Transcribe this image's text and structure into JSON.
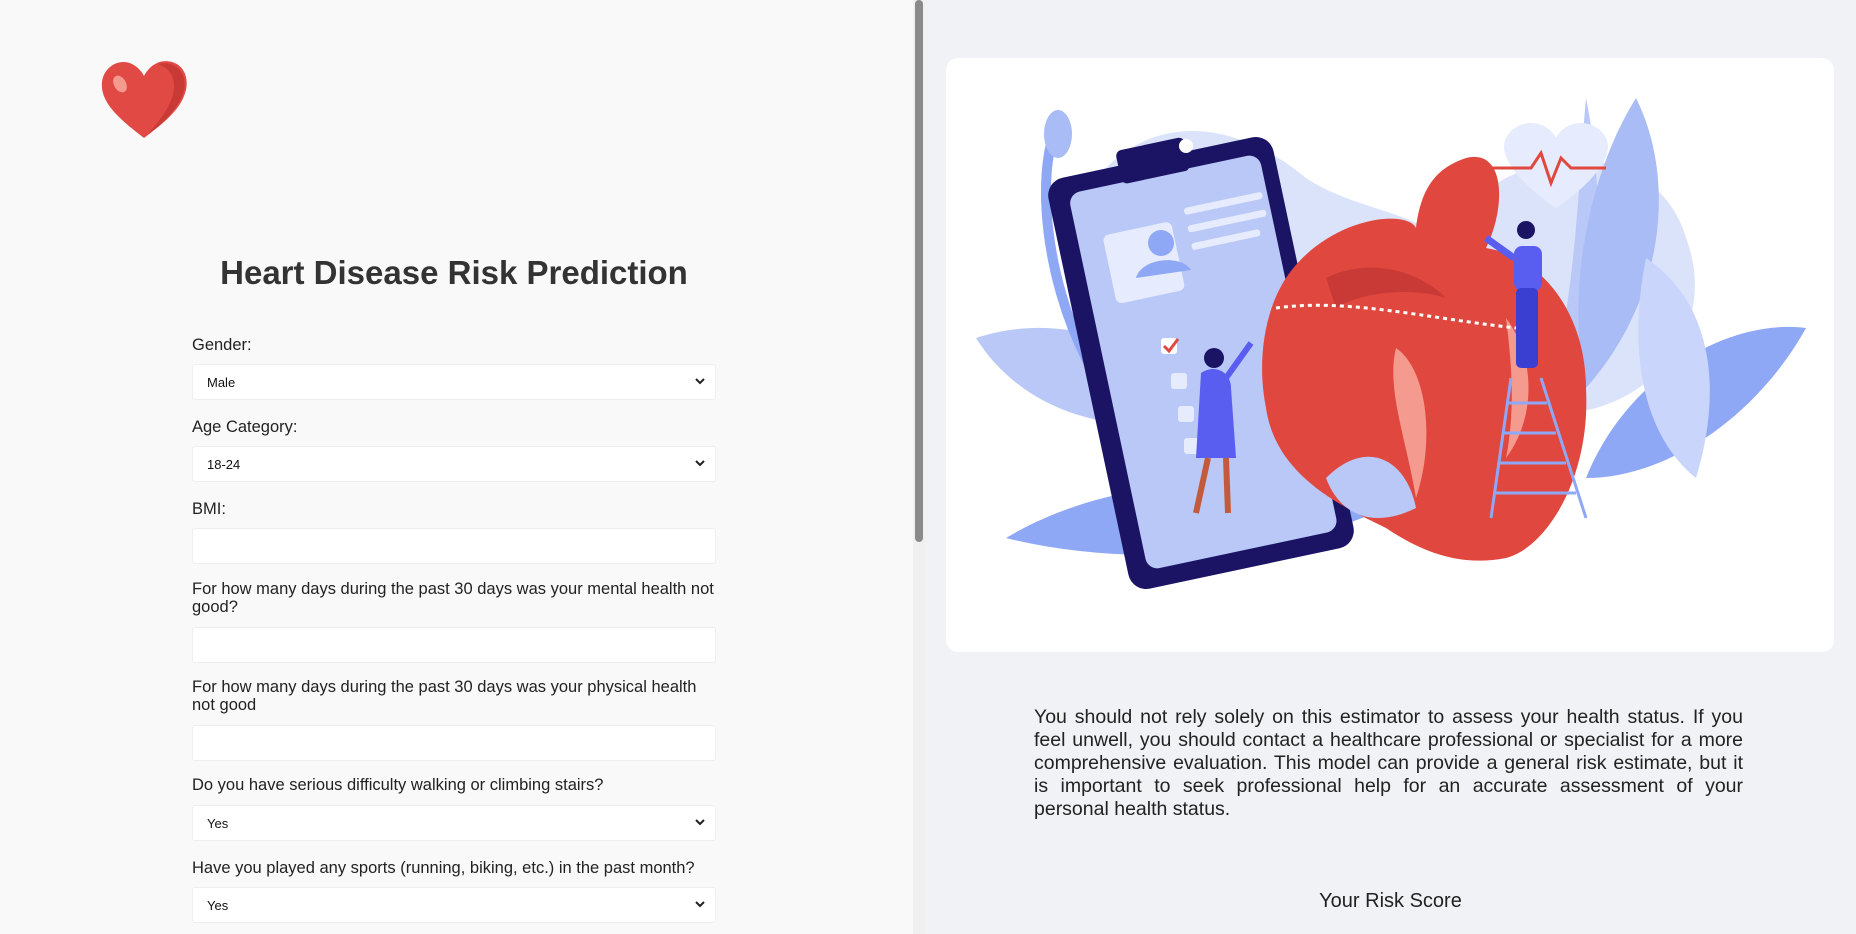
{
  "app": {
    "title": "Heart Disease Risk Prediction"
  },
  "form": {
    "gender": {
      "label": "Gender:",
      "value": "Male"
    },
    "age": {
      "label": "Age Category:",
      "value": "18-24"
    },
    "bmi": {
      "label": "BMI:",
      "value": ""
    },
    "mental": {
      "label": "For how many days during the past 30 days was your mental health not good?",
      "value": ""
    },
    "physical": {
      "label": "For how many days during the past 30 days was your physical health not good",
      "value": ""
    },
    "walking": {
      "label": "Do you have serious difficulty walking or climbing stairs?",
      "value": "Yes"
    },
    "sports": {
      "label": "Have you played any sports (running, biking, etc.) in the past month?",
      "value": "Yes"
    }
  },
  "right": {
    "disclaimer": "You should not rely solely on this estimator to assess your health status. If you feel unwell, you should contact a healthcare professional or specialist for a more comprehensive evaluation. This model can provide a general risk estimate, but it is important to seek professional help for an accurate assessment of your personal health status.",
    "risk_title": "Your Risk Score"
  },
  "icons": {
    "logo": "heart-icon",
    "select_arrow": "chevron-down-icon"
  },
  "colors": {
    "accent_red": "#e0483f",
    "illustration_blue": "#8fa8f5",
    "dark_navy": "#1b1464"
  }
}
